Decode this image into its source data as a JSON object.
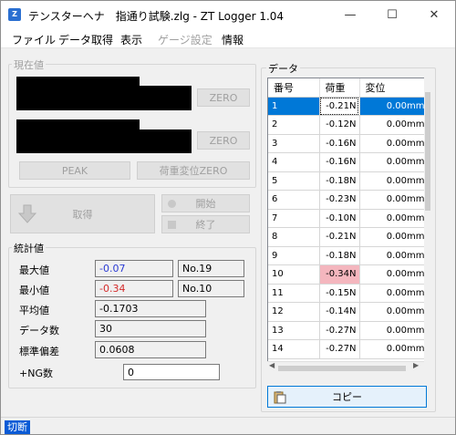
{
  "window": {
    "title": "テンスターヘナ　指通り試験.zlg - ZT Logger 1.04",
    "minimize_glyph": "—",
    "maximize_glyph": "☐",
    "close_glyph": "✕",
    "icon_letter": "Z"
  },
  "menu": [
    {
      "label": "ファイル",
      "enabled": true
    },
    {
      "label": "データ取得",
      "enabled": true
    },
    {
      "label": "表示",
      "enabled": true
    },
    {
      "label": "ゲージ設定",
      "enabled": false
    },
    {
      "label": "情報",
      "enabled": true
    }
  ],
  "current": {
    "title": "現在値",
    "zero1": "ZERO",
    "zero2": "ZERO",
    "peak": "PEAK",
    "load_disp_zero": "荷重変位ZERO"
  },
  "acquire": {
    "get_label": "取得",
    "start_label": "開始",
    "stop_label": "終了"
  },
  "stats": {
    "title": "統計値",
    "max_label": "最大値",
    "max_value": "-0.07",
    "max_no": "No.19",
    "min_label": "最小値",
    "min_value": "-0.34",
    "min_no": "No.10",
    "avg_label": "平均値",
    "avg_value": "-0.1703",
    "count_label": "データ数",
    "count_value": "30",
    "std_label": "標準偏差",
    "std_value": "0.0608",
    "ng_label": "+NG数",
    "ng_value": "0",
    "max_color": "#2b3bd4",
    "min_color": "#d42b2b"
  },
  "data_panel": {
    "title": "データ",
    "columns": [
      "番号",
      "荷重",
      "変位"
    ],
    "rows": [
      {
        "no": "1",
        "load": "-0.21N",
        "disp": "0.00mm"
      },
      {
        "no": "2",
        "load": "-0.12N",
        "disp": "0.00mm"
      },
      {
        "no": "3",
        "load": "-0.16N",
        "disp": "0.00mm"
      },
      {
        "no": "4",
        "load": "-0.16N",
        "disp": "0.00mm"
      },
      {
        "no": "5",
        "load": "-0.18N",
        "disp": "0.00mm"
      },
      {
        "no": "6",
        "load": "-0.23N",
        "disp": "0.00mm"
      },
      {
        "no": "7",
        "load": "-0.10N",
        "disp": "0.00mm"
      },
      {
        "no": "8",
        "load": "-0.21N",
        "disp": "0.00mm"
      },
      {
        "no": "9",
        "load": "-0.18N",
        "disp": "0.00mm"
      },
      {
        "no": "10",
        "load": "-0.34N",
        "disp": "0.00mm"
      },
      {
        "no": "11",
        "load": "-0.15N",
        "disp": "0.00mm"
      },
      {
        "no": "12",
        "load": "-0.14N",
        "disp": "0.00mm"
      },
      {
        "no": "13",
        "load": "-0.27N",
        "disp": "0.00mm"
      },
      {
        "no": "14",
        "load": "-0.27N",
        "disp": "0.00mm"
      }
    ],
    "selected_row": 1,
    "highlight_row": 10,
    "copy_label": "コピー"
  },
  "status": {
    "label": "切断"
  },
  "colors": {
    "accent": "#0078d7",
    "highlight": "#f4b6be",
    "status_bg": "#0a5bd6"
  }
}
